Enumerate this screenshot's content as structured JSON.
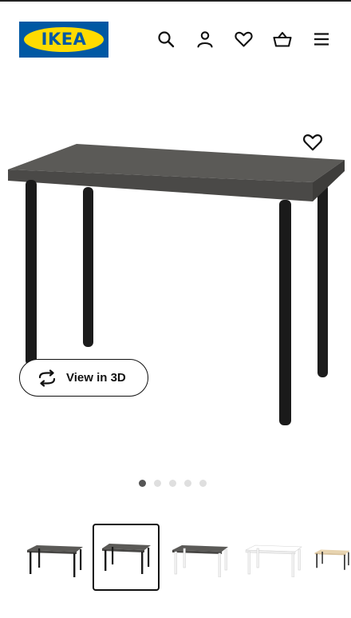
{
  "brand": {
    "logo_text": "IKEA",
    "primary_blue": "#0058a3",
    "yellow": "#ffdb00"
  },
  "header": {
    "icons": [
      "search-icon",
      "account-icon",
      "heart-icon",
      "basket-icon",
      "menu-icon"
    ]
  },
  "product": {
    "tabletop_color": "#5b5a57",
    "leg_color": "#1a1a1a",
    "favourite_icon": "heart-outline-icon",
    "view_3d": {
      "label": "View in 3D",
      "icon": "rotate-3d-icon"
    }
  },
  "carousel": {
    "total_dots": 5,
    "active_index": 0
  },
  "thumbnails": [
    {
      "name": "dark-grey-black",
      "top": "#5b5a57",
      "legs": "#1a1a1a",
      "selected": false
    },
    {
      "name": "dark-grey-black-alt",
      "top": "#5b5a57",
      "legs": "#1a1a1a",
      "selected": true
    },
    {
      "name": "dark-grey-white",
      "top": "#5b5a57",
      "legs": "#f2f2f2",
      "selected": false
    },
    {
      "name": "white-white",
      "top": "#ffffff",
      "legs": "#f2f2f2",
      "selected": false
    },
    {
      "name": "birch-black",
      "top": "#e8d4b0",
      "legs": "#1a1a1a",
      "selected": false
    }
  ]
}
